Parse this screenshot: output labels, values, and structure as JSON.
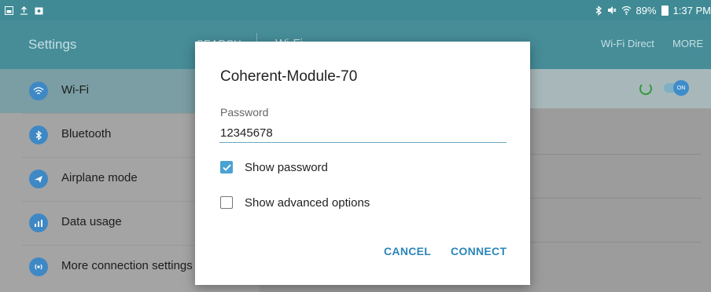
{
  "status_bar": {
    "icons_left": [
      "gallery-icon",
      "upload-icon",
      "image-icon"
    ],
    "battery": "89%",
    "time": "1:37 PM"
  },
  "app_bar": {
    "title": "Settings",
    "search": "SEARCH",
    "subtitle": "Wi-Fi",
    "wifi_direct": "Wi-Fi Direct",
    "more": "MORE"
  },
  "left_list": [
    {
      "label": "Wi-Fi",
      "icon": "wifi-icon",
      "active": true
    },
    {
      "label": "Bluetooth",
      "icon": "bluetooth-icon",
      "active": false
    },
    {
      "label": "Airplane mode",
      "icon": "airplane-icon",
      "active": false
    },
    {
      "label": "Data usage",
      "icon": "data-usage-icon",
      "active": false
    },
    {
      "label": "More connection settings",
      "icon": "more-connection-icon",
      "active": false
    }
  ],
  "right_pane": {
    "toggle_label": "ON"
  },
  "dialog": {
    "title": "Coherent-Module-70",
    "password_label": "Password",
    "password_value": "12345678",
    "show_password_label": "Show password",
    "show_password_checked": true,
    "advanced_label": "Show advanced options",
    "advanced_checked": false,
    "cancel_label": "CANCEL",
    "connect_label": "CONNECT"
  },
  "colors": {
    "accent": "#2c86b8",
    "appbar": "#468d98",
    "checkbox": "#4aa2d2"
  }
}
